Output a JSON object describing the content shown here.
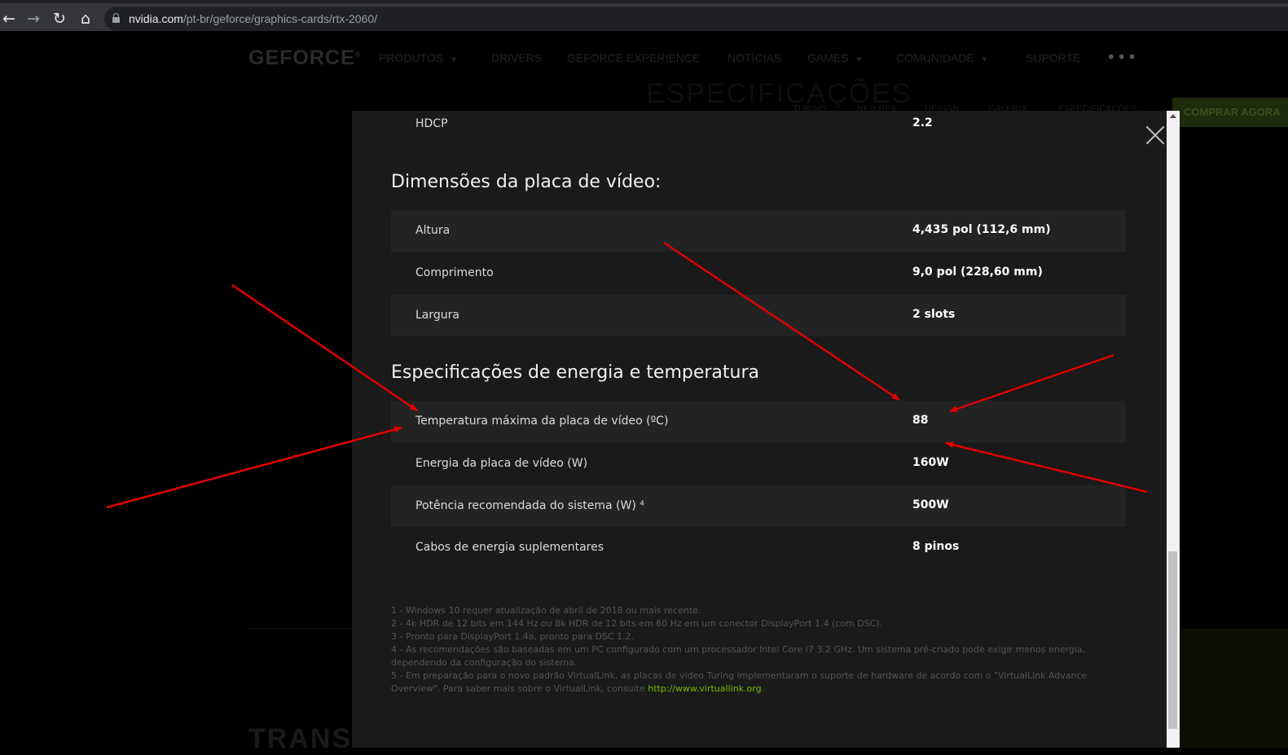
{
  "browser": {
    "url_host": "nvidia.com",
    "url_path": "/pt-br/geforce/graphics-cards/rtx-2060/"
  },
  "background": {
    "logo": "GEFORCE",
    "nav": [
      {
        "label": "PRODUTOS",
        "dropdown": true
      },
      {
        "label": "DRIVERS"
      },
      {
        "label": "GEFORCE EXPERIENCE"
      },
      {
        "label": "NOTÍCIAS"
      },
      {
        "label": "GAMES",
        "dropdown": true
      },
      {
        "label": "COMUNIDADE",
        "dropdown": true
      },
      {
        "label": "SUPORTE"
      }
    ],
    "more": "•••",
    "headline": "ESPECIFICAÇÕES",
    "subnav": [
      "TURING",
      "NED RPX",
      "DESIGN",
      "GALERIA",
      "ESPECIFICAÇÕES"
    ],
    "buy_button": "COMPRAR AGORA",
    "bottom_heading": "TRANS"
  },
  "modal": {
    "hdcp": {
      "label": "HDCP",
      "value": "2.2"
    },
    "dimensions_title": "Dimensões da placa de vídeo:",
    "dimensions": [
      {
        "label": "Altura",
        "value": "4,435 pol (112,6 mm)"
      },
      {
        "label": "Comprimento",
        "value": "9,0 pol (228,60 mm)"
      },
      {
        "label": "Largura",
        "value": "2 slots"
      }
    ],
    "power_title": "Especificações de energia e temperatura",
    "power": [
      {
        "label": "Temperatura máxima da placa de vídeo (ºC)",
        "value": "88"
      },
      {
        "label": "Energia da placa de vídeo (W)",
        "value": "160W"
      },
      {
        "label": "Potência recomendada do sistema (W) ⁴",
        "value": "500W"
      },
      {
        "label": "Cabos de energia suplementares",
        "value": "8 pinos"
      }
    ],
    "footnotes": [
      "1 - Windows 10 requer atualização de abril de 2018 ou mais recente.",
      "2 - 4k HDR de 12 bits em 144 Hz ou 8k HDR de 12 bits em 60 Hz em um conector DisplayPort 1.4 (com DSC).",
      "3 - Pronto para DisplayPort 1.4a, pronto para DSC 1.2.",
      "4 - As recomendações são baseadas em um PC configurado com um processador Intel Core i7 3.2 GHz. Um sistema pré-criado pode exigir menos energia, dependendo da configuração do sistema.",
      "5 - Em preparação para o novo padrão VirtualLink, as placas de vídeo Turing implementaram o suporte de hardware de acordo com o \"VirtualLink Advance Overview\". Para saber mais sobre o VirtualLink, consulte"
    ],
    "footnote_link": "http://www.virtuallink.org",
    "footnote_end": "."
  },
  "colors": {
    "modal_bg": "#1a1a1a",
    "row_shade": "#232323",
    "link_green": "#76b900",
    "arrow_red": "#e00000"
  }
}
